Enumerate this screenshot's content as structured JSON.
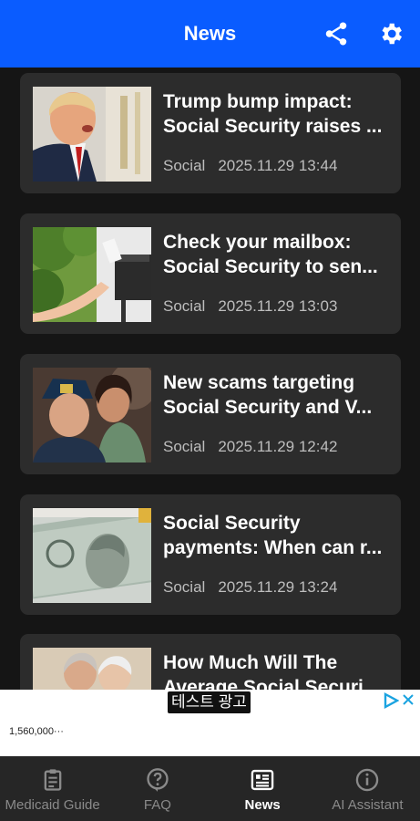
{
  "header": {
    "title": "News"
  },
  "articles": [
    {
      "headline_line1": "Trump bump impact:",
      "headline_line2": "Social Security raises ...",
      "category": "Social",
      "timestamp": "2025.11.29 13:44"
    },
    {
      "headline_line1": "Check your mailbox:",
      "headline_line2": "Social Security to sen...",
      "category": "Social",
      "timestamp": "2025.11.29 13:03"
    },
    {
      "headline_line1": "New scams targeting",
      "headline_line2": "Social Security and V...",
      "category": "Social",
      "timestamp": "2025.11.29 12:42"
    },
    {
      "headline_line1": "Social Security",
      "headline_line2": "payments: When can r...",
      "category": "Social",
      "timestamp": "2025.11.29 13:24"
    },
    {
      "headline_line1": "How Much Will The",
      "headline_line2": "Average Social Securi...",
      "category": "",
      "timestamp": ""
    }
  ],
  "ad": {
    "label": "테스트 광고",
    "text": "1,560,000···"
  },
  "nav": {
    "items": [
      {
        "label": "Medicaid Guide",
        "icon": "clipboard-icon"
      },
      {
        "label": "FAQ",
        "icon": "question-icon"
      },
      {
        "label": "News",
        "icon": "news-icon"
      },
      {
        "label": "AI Assistant",
        "icon": "info-icon"
      }
    ],
    "active": "News"
  },
  "colors": {
    "header": "#0a5cff",
    "background": "#151515",
    "card": "#2c2c2c",
    "nav": "#262626"
  }
}
